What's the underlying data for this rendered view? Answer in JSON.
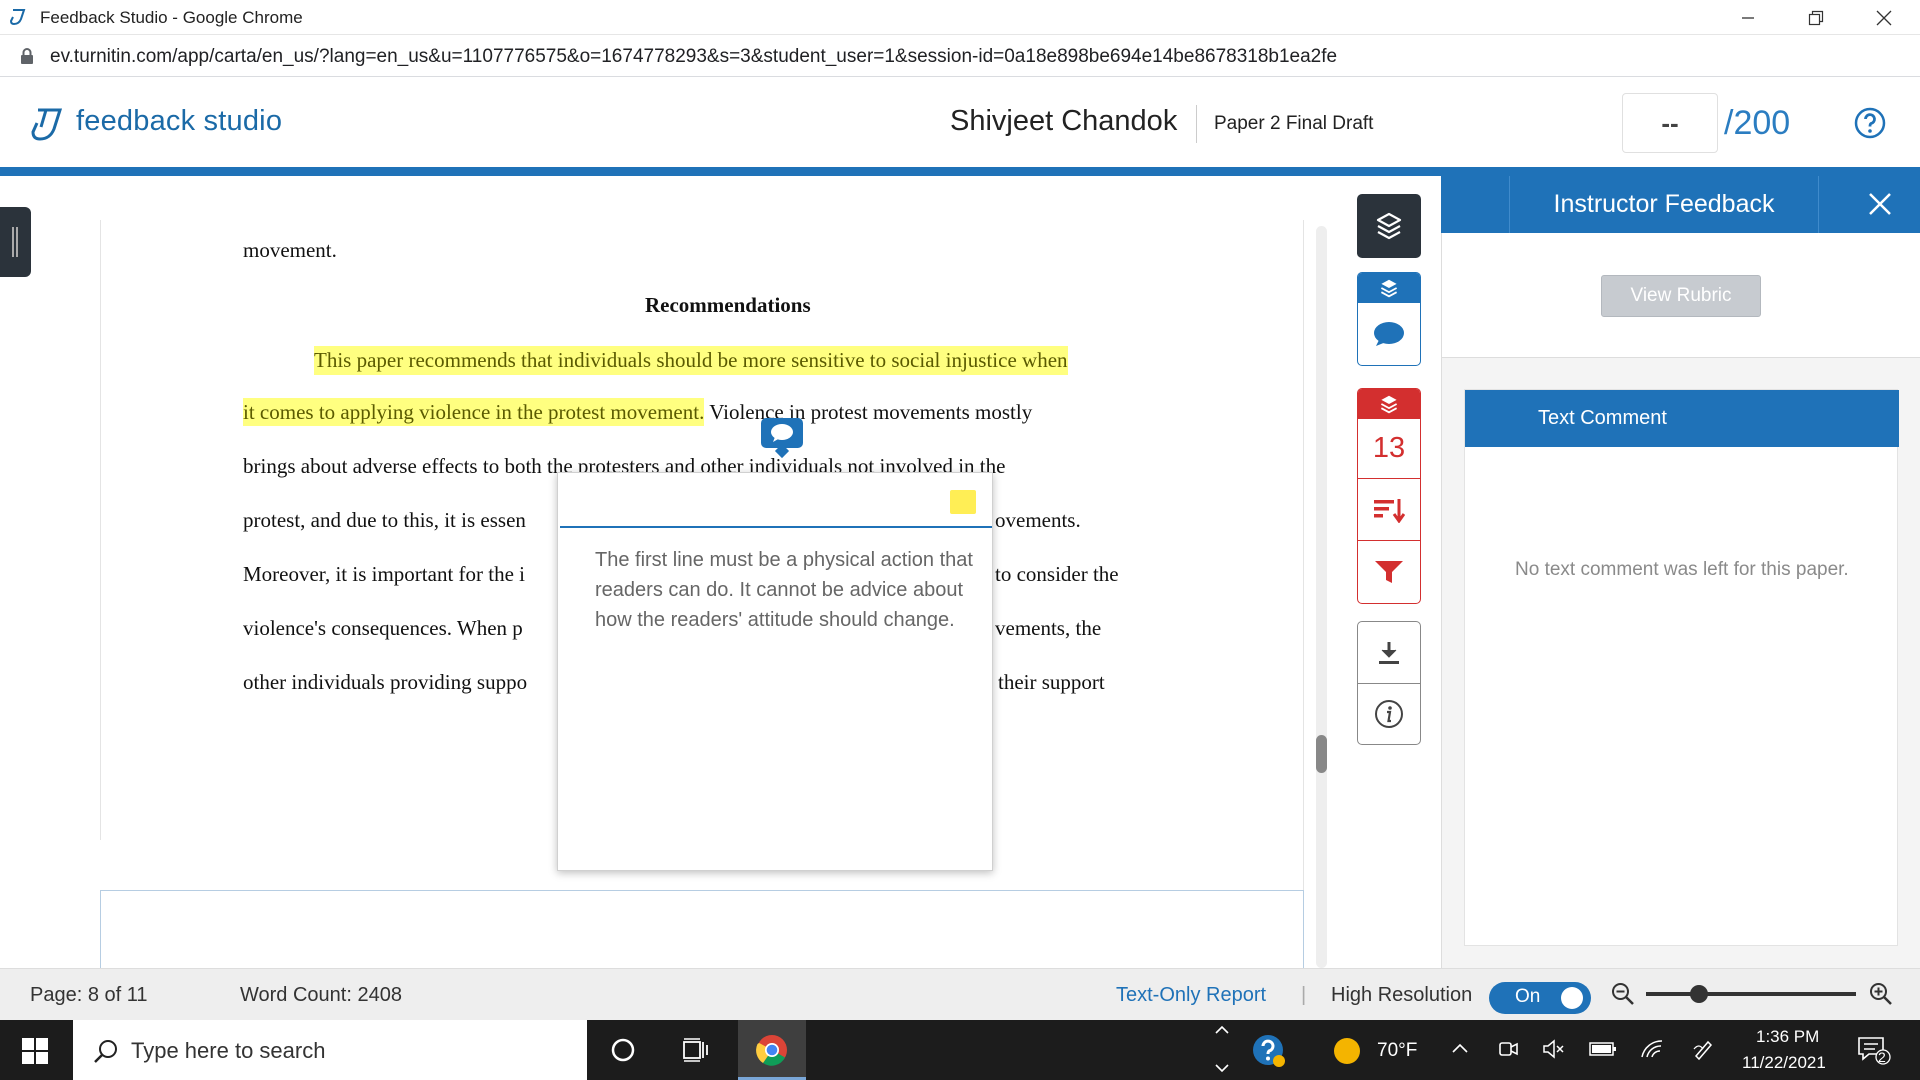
{
  "browser": {
    "window_title": "Feedback Studio - Google Chrome",
    "url": "ev.turnitin.com/app/carta/en_us/?lang=en_us&u=1107776575&o=1674778293&s=3&student_user=1&session-id=0a18e898be694e14be8678318b1ea2fe"
  },
  "header": {
    "logo_text": "feedback studio",
    "student_name": "Shivjeet Chandok",
    "paper_title": "Paper 2 Final Draft",
    "score": "--",
    "score_total": "/200"
  },
  "document": {
    "line_prev": "movement.",
    "heading": "Recommendations",
    "line1_highlight": "This paper recommends that individuals should be more sensitive to social injustice when",
    "line2_highlight": "it comes to applying violence in the protest movement.",
    "line2_rest": " Violence in protest movements mostly",
    "line3": "brings about adverse effects to both the protesters and other individuals not involved in the",
    "line4_left": "protest, and due to this, it is essen",
    "line4_right": "ovements.",
    "line5_left": "Moreover, it is important for the i",
    "line5_right": "to consider the",
    "line6_left": "violence's consequences. When p",
    "line6_right": "vements, the",
    "line7_left": "other individuals providing suppo",
    "line7_right": "their support"
  },
  "comment_popup": {
    "text": "The first line must be a physical action that readers can do. It cannot be advice about how the readers' attitude should change.",
    "highlight_color": "#ffee55"
  },
  "tools": {
    "count": "13"
  },
  "right_panel": {
    "title": "Instructor Feedback",
    "view_rubric": "View Rubric",
    "text_comment_title": "Text Comment",
    "no_comment": "No text comment was left for this paper."
  },
  "status_bar": {
    "page": "Page: 8 of 11",
    "word_count": "Word Count: 2408",
    "text_only": "Text-Only Report",
    "separator": "|",
    "high_res": "High Resolution",
    "toggle": "On"
  },
  "taskbar": {
    "search_placeholder": "Type here to search",
    "temperature": "70°F",
    "time": "1:36 PM",
    "date": "11/22/2021",
    "notifications": "2"
  },
  "colors": {
    "brand_blue": "#1f72b8",
    "alert_red": "#d32f2f",
    "highlight_yellow": "#ffff80"
  }
}
